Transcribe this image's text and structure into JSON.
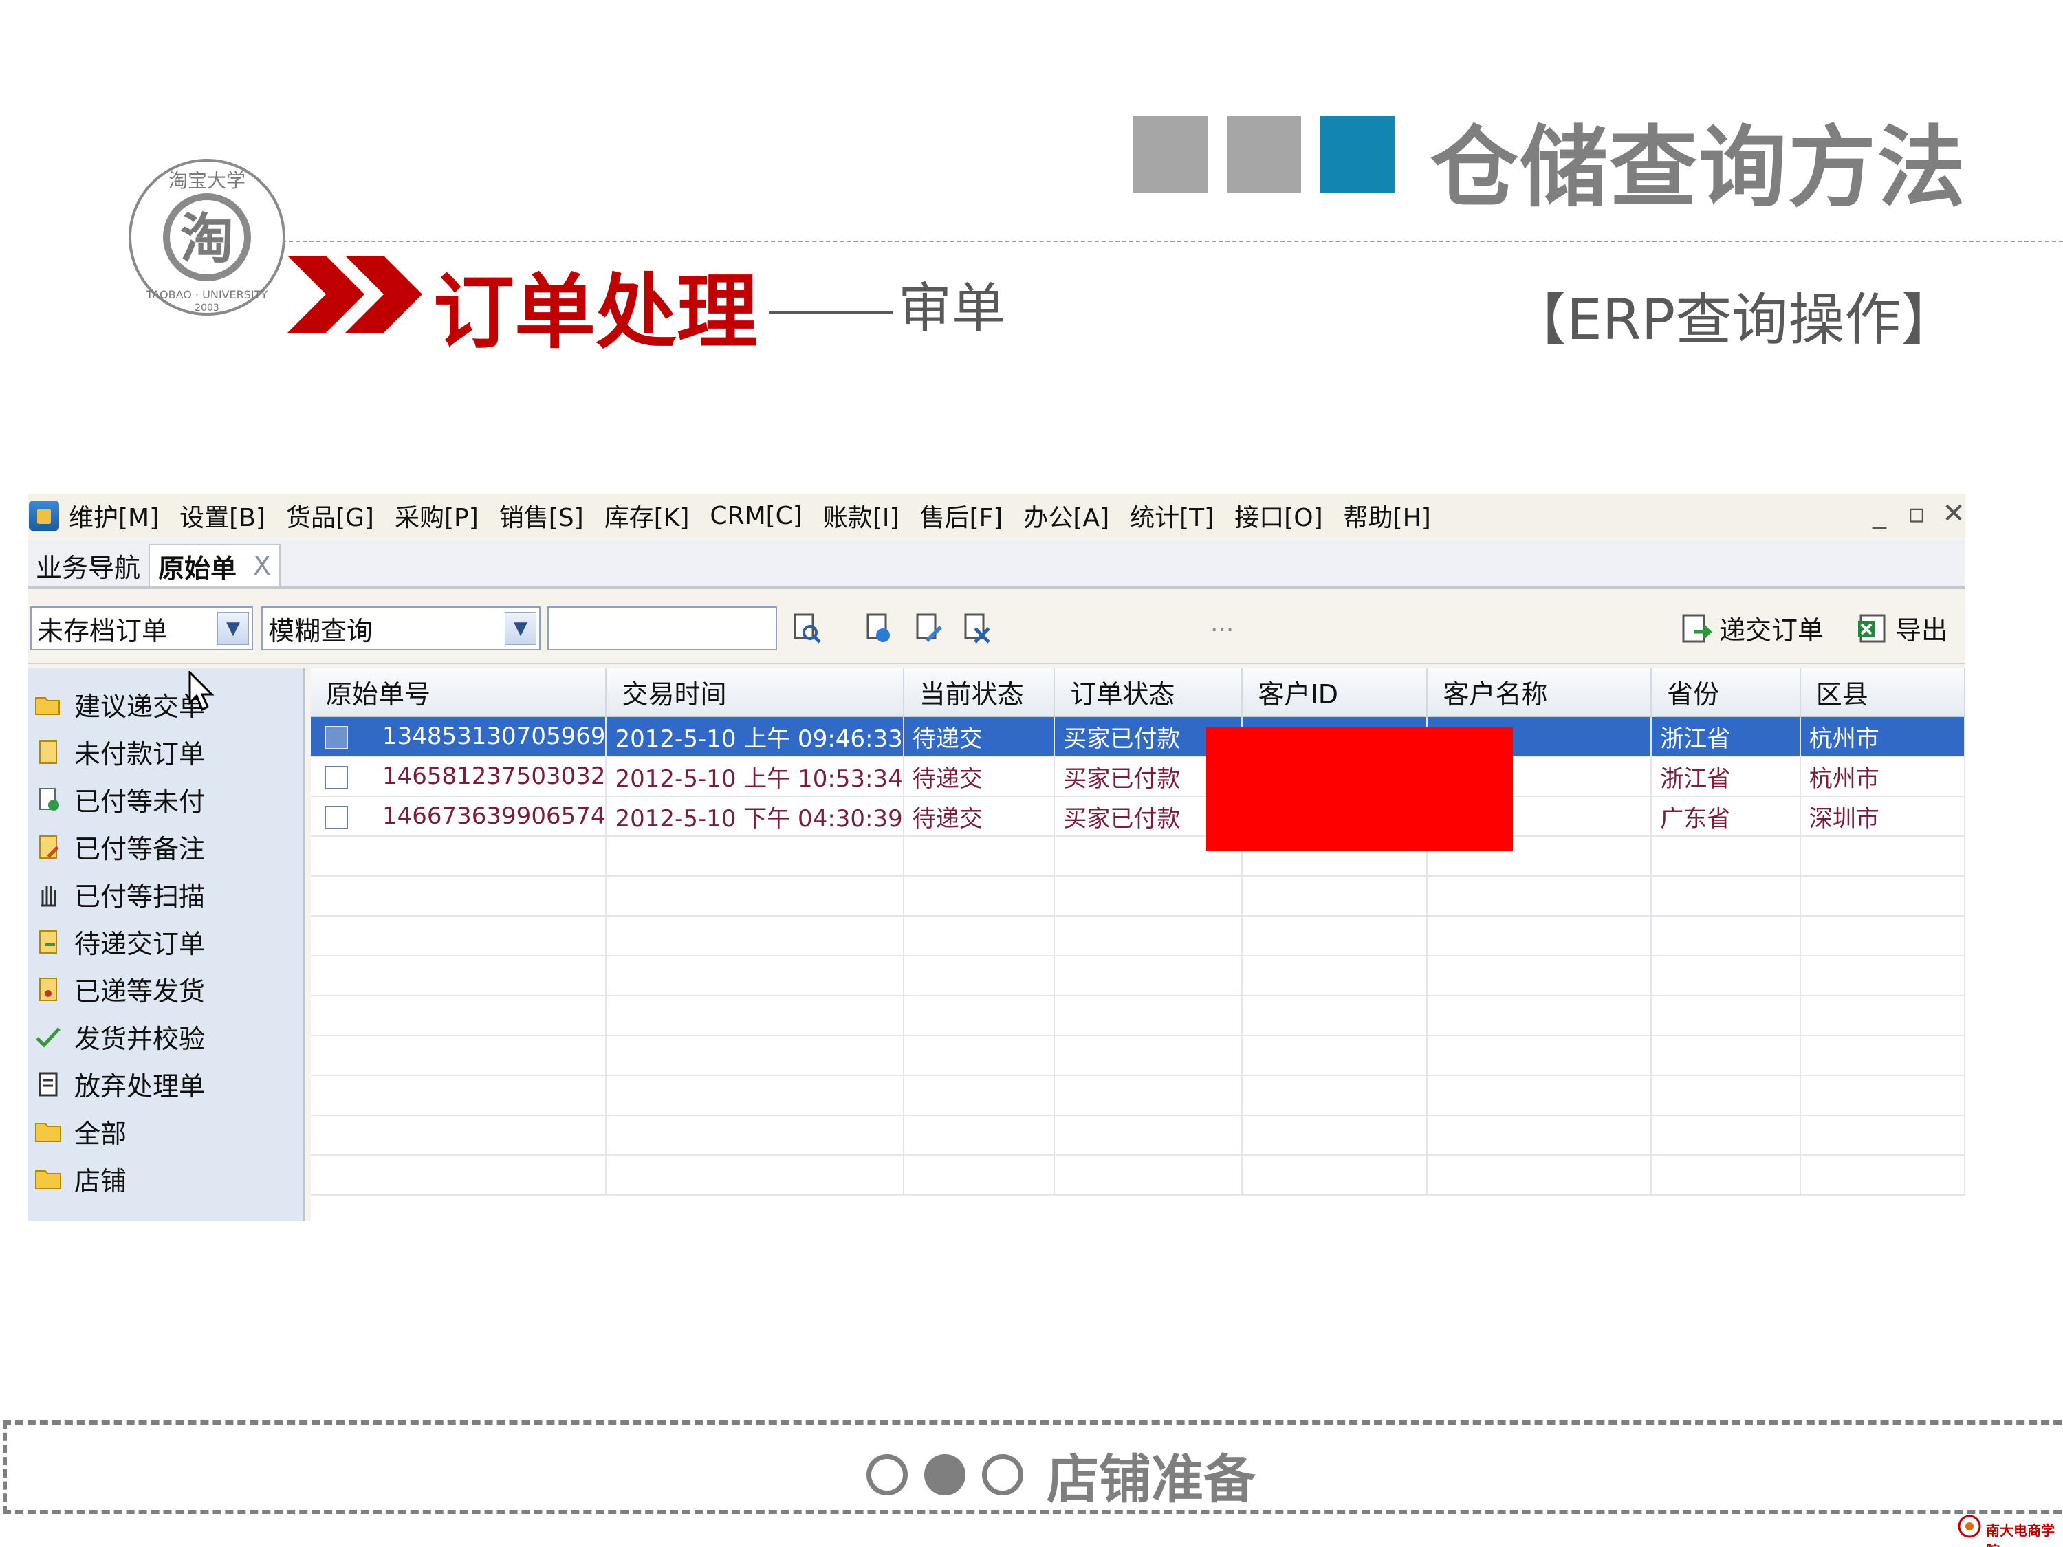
{
  "slide": {
    "title": "仓储查询方法",
    "section_title": "订单处理",
    "section_sub": "审单",
    "erp_label": "【ERP查询操作】",
    "logo_text": "淘宝大学",
    "logo_char": "淘",
    "logo_en": "TAOBAO · UNIVERSITY",
    "logo_year": "2003",
    "footer_text": "店铺准备",
    "corner_logo_text": "南大电商学院",
    "colors": {
      "accent_blue": "#1385b1",
      "grey": "#a6a6a6",
      "red": "#c00000"
    }
  },
  "erp": {
    "menu": [
      "维护[M]",
      "设置[B]",
      "货品[G]",
      "采购[P]",
      "销售[S]",
      "库存[K]",
      "CRM[C]",
      "账款[I]",
      "售后[F]",
      "办公[A]",
      "统计[T]",
      "接口[O]",
      "帮助[H]"
    ],
    "window_controls": [
      "_",
      "▫",
      "✕"
    ],
    "tabs": {
      "nav": "业务导航",
      "active": "原始单",
      "close": "X"
    },
    "toolbar": {
      "filter_select": "未存档订单",
      "query_select": "模糊查询",
      "search_value": "",
      "ellipsis": "...",
      "submit_label": "递交订单",
      "export_label": "导出"
    },
    "nav": [
      {
        "label": "建议递交单",
        "icon": "folder-open-icon"
      },
      {
        "label": "未付款订单",
        "icon": "document-icon"
      },
      {
        "label": "已付等未付",
        "icon": "user-document-icon"
      },
      {
        "label": "已付等备注",
        "icon": "note-icon"
      },
      {
        "label": "已付等扫描",
        "icon": "hand-icon"
      },
      {
        "label": "待递交订单",
        "icon": "document-icon"
      },
      {
        "label": "已递等发货",
        "icon": "package-icon"
      },
      {
        "label": "发货并校验",
        "icon": "check-icon"
      },
      {
        "label": "放弃处理单",
        "icon": "form-icon"
      },
      {
        "label": "全部",
        "icon": "folder-icon"
      },
      {
        "label": "店铺",
        "icon": "folder-icon"
      }
    ],
    "columns": [
      "原始单号",
      "交易时间",
      "当前状态",
      "订单状态",
      "客户ID",
      "客户名称",
      "省份",
      "区县"
    ],
    "rows": [
      {
        "order": "134853130705969",
        "time": "2012-5-10 上午 09:46:33",
        "status": "待递交",
        "order_status": "买家已付款",
        "customer_id": "",
        "customer_name": "",
        "province": "浙江省",
        "district": "杭州市",
        "selected": true
      },
      {
        "order": "146581237503032",
        "time": "2012-5-10 上午 10:53:34",
        "status": "待递交",
        "order_status": "买家已付款",
        "customer_id": "",
        "customer_name": "",
        "province": "浙江省",
        "district": "杭州市",
        "selected": false
      },
      {
        "order": "146673639906574",
        "time": "2012-5-10 下午 04:30:39",
        "status": "待递交",
        "order_status": "买家已付款",
        "customer_id": "",
        "customer_name": "",
        "province": "广东省",
        "district": "深圳市",
        "selected": false
      }
    ]
  }
}
